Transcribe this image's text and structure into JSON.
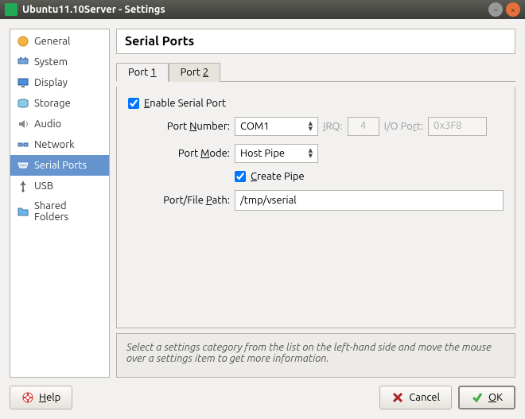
{
  "window": {
    "title": "Ubuntu11.10Server - Settings"
  },
  "sidebar": {
    "items": [
      {
        "label": "General"
      },
      {
        "label": "System"
      },
      {
        "label": "Display"
      },
      {
        "label": "Storage"
      },
      {
        "label": "Audio"
      },
      {
        "label": "Network"
      },
      {
        "label": "Serial Ports"
      },
      {
        "label": "USB"
      },
      {
        "label": "Shared Folders"
      }
    ]
  },
  "panel": {
    "heading": "Serial Ports",
    "tabs": [
      {
        "label_pre": "Port ",
        "label_ul": "1"
      },
      {
        "label_pre": "Port ",
        "label_ul": "2"
      }
    ],
    "enable_pre": "",
    "enable_ul": "E",
    "enable_post": "nable Serial Port",
    "port_number_label_pre": "Port ",
    "port_number_label_ul": "N",
    "port_number_label_post": "umber:",
    "port_number_value": "COM1",
    "irq_label_ul": "I",
    "irq_label_post": "RQ:",
    "irq_value": "4",
    "ioport_label_pre": "I/O Po",
    "ioport_label_ul": "r",
    "ioport_label_post": "t:",
    "ioport_value": "0x3F8",
    "port_mode_label_pre": "Port ",
    "port_mode_label_ul": "M",
    "port_mode_label_post": "ode:",
    "port_mode_value": "Host Pipe",
    "create_pipe_ul": "C",
    "create_pipe_post": "reate Pipe",
    "path_label_pre": "Port/File ",
    "path_label_ul": "P",
    "path_label_post": "ath:",
    "path_value": "/tmp/vserial"
  },
  "hint": "Select a settings category from the list on the left-hand side and move the mouse over a settings item to get more information.",
  "buttons": {
    "help_ul": "H",
    "help_post": "elp",
    "cancel_label": "Cancel",
    "ok_ul": "O",
    "ok_post": "K"
  }
}
